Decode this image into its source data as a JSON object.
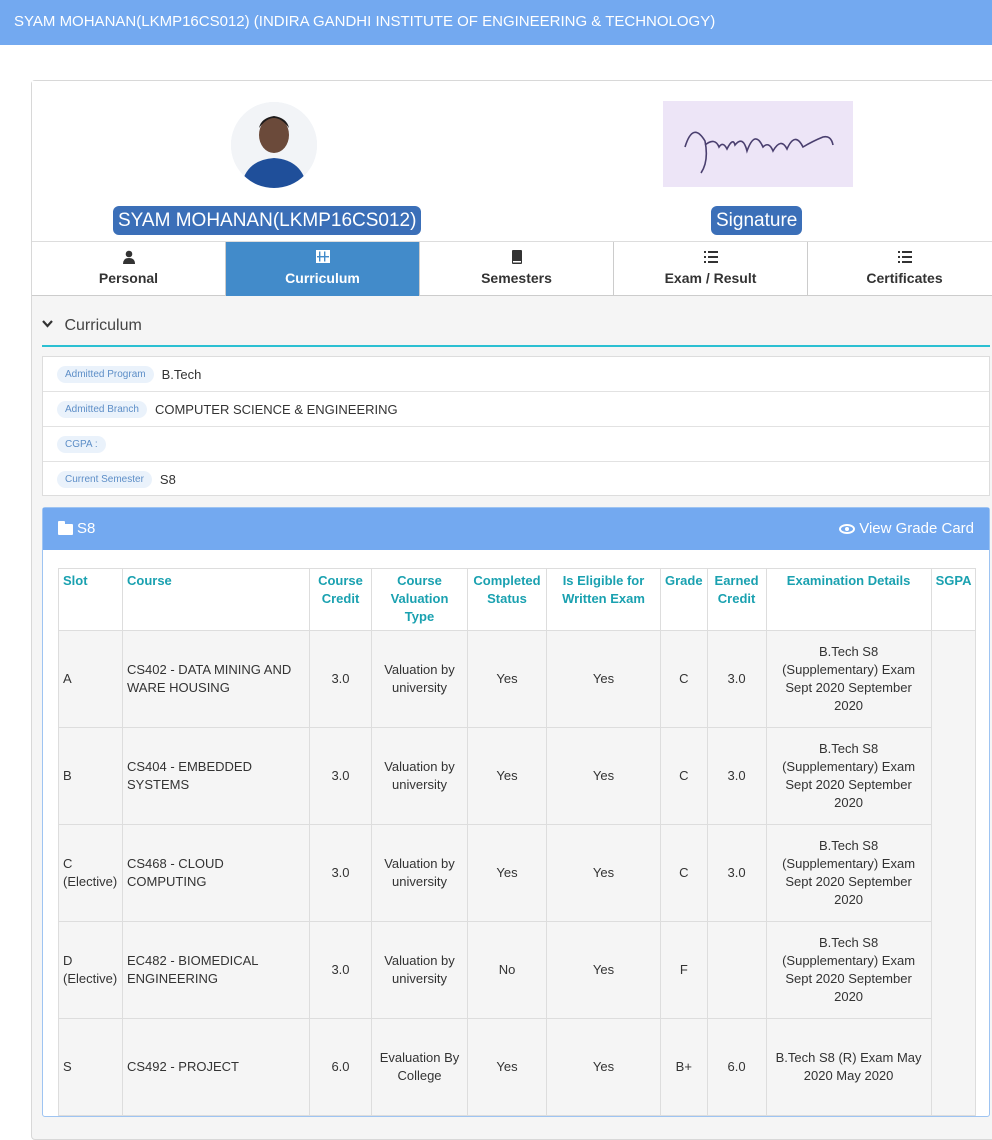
{
  "header": {
    "title": "SYAM MOHANAN(LKMP16CS012) (INDIRA GANDHI INSTITUTE OF ENGINEERING & TECHNOLOGY)"
  },
  "profile": {
    "name": "SYAM MOHANAN(LKMP16CS012)",
    "signature_label": "Signature"
  },
  "tabs": [
    {
      "label": "Personal",
      "icon": "user-icon"
    },
    {
      "label": "Curriculum",
      "icon": "grid-icon"
    },
    {
      "label": "Semesters",
      "icon": "book-icon"
    },
    {
      "label": "Exam / Result",
      "icon": "list-icon"
    },
    {
      "label": "Certificates",
      "icon": "list-icon"
    }
  ],
  "section": {
    "title": "Curriculum"
  },
  "info": {
    "program_label": "Admitted Program",
    "program_value": "B.Tech",
    "branch_label": "Admitted Branch",
    "branch_value": "COMPUTER SCIENCE & ENGINEERING",
    "cgpa_label": "CGPA :",
    "cgpa_value": "",
    "semester_label": "Current Semester",
    "semester_value": "S8"
  },
  "panel": {
    "title": "S8",
    "action": "View Grade Card"
  },
  "table": {
    "headers": [
      "Slot",
      "Course",
      "Course Credit",
      "Course Valuation Type",
      "Completed Status",
      "Is Eligible for Written Exam",
      "Grade",
      "Earned Credit",
      "Examination Details",
      "SGPA"
    ],
    "rows": [
      {
        "slot": "A",
        "course": "CS402 - DATA MINING AND WARE HOUSING",
        "credit": "3.0",
        "valuation": "Valuation by university",
        "completed": "Yes",
        "eligible": "Yes",
        "grade": "C",
        "earned": "3.0",
        "exam": "B.Tech S8 (Supplementary) Exam Sept 2020 September 2020"
      },
      {
        "slot": "B",
        "course": "CS404 - EMBEDDED SYSTEMS",
        "credit": "3.0",
        "valuation": "Valuation by university",
        "completed": "Yes",
        "eligible": "Yes",
        "grade": "C",
        "earned": "3.0",
        "exam": "B.Tech S8 (Supplementary) Exam Sept 2020 September 2020"
      },
      {
        "slot": "C (Elective)",
        "course": "CS468 - CLOUD COMPUTING",
        "credit": "3.0",
        "valuation": "Valuation by university",
        "completed": "Yes",
        "eligible": "Yes",
        "grade": "C",
        "earned": "3.0",
        "exam": "B.Tech S8 (Supplementary) Exam Sept 2020 September 2020"
      },
      {
        "slot": "D (Elective)",
        "course": "EC482 - BIOMEDICAL ENGINEERING",
        "credit": "3.0",
        "valuation": "Valuation by university",
        "completed": "No",
        "eligible": "Yes",
        "grade": "F",
        "earned": "",
        "exam": "B.Tech S8 (Supplementary) Exam Sept 2020 September 2020"
      },
      {
        "slot": "S",
        "course": "CS492 - PROJECT",
        "credit": "6.0",
        "valuation": "Evaluation By College",
        "completed": "Yes",
        "eligible": "Yes",
        "grade": "B+",
        "earned": "6.0",
        "exam": "B.Tech S8 (R) Exam May 2020 May 2020"
      }
    ]
  }
}
